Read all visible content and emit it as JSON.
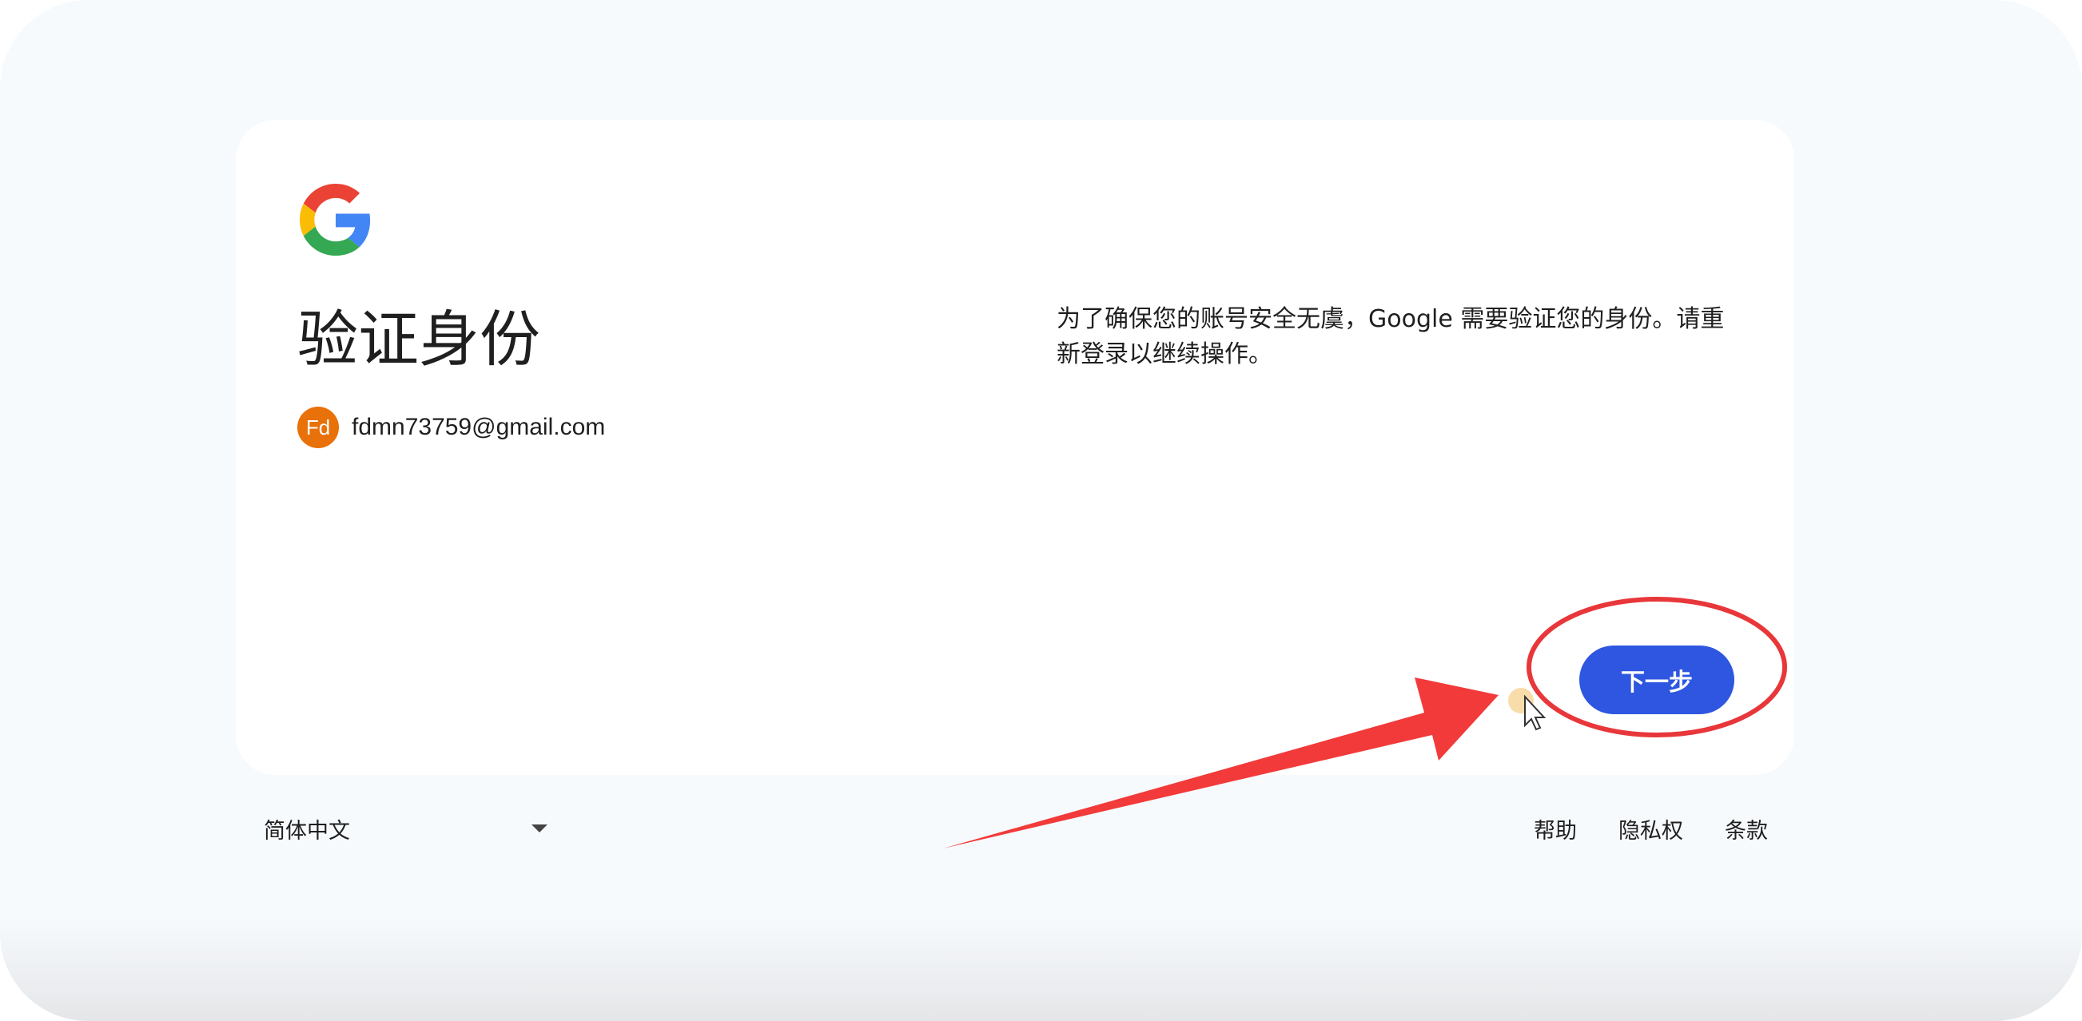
{
  "page": {
    "title": "验证身份",
    "message": "为了确保您的账号安全无虞，Google 需要验证您的身份。请重新登录以继续操作。"
  },
  "account": {
    "avatar_initials": "Fd",
    "avatar_color": "#e8710a",
    "email": "fdmn73759@gmail.com"
  },
  "actions": {
    "next_label": "下一步",
    "next_color": "#2e56e0"
  },
  "footer": {
    "language": "简体中文",
    "links": [
      "帮助",
      "隐私权",
      "条款"
    ]
  },
  "annotation": {
    "arrow_color": "#f23a3a",
    "circle_color": "#e8373a"
  }
}
